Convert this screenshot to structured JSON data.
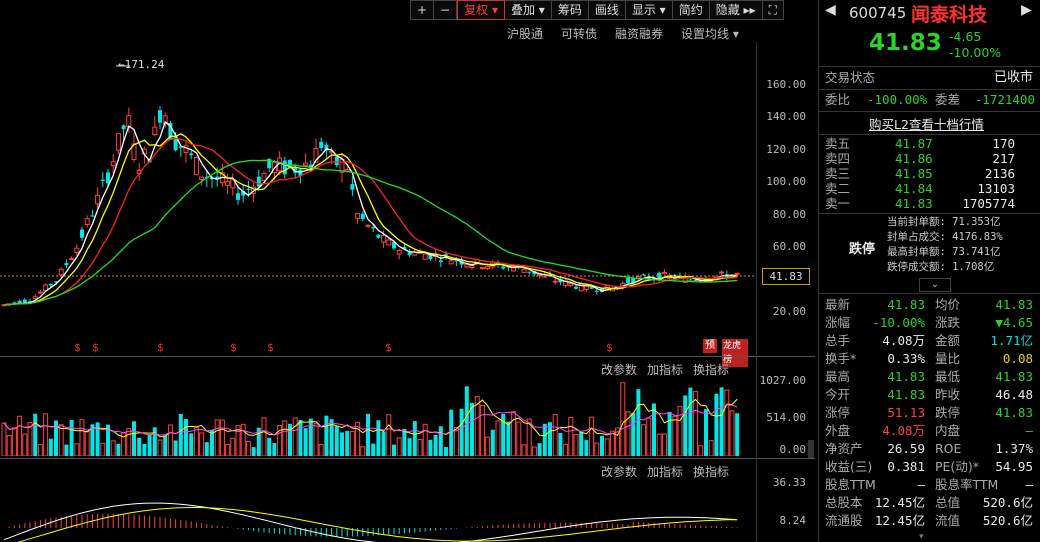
{
  "toolbar": {
    "items": [
      "+",
      "−",
      "复权 ▾",
      "叠加 ▾",
      "筹码",
      "画线",
      "显示 ▾",
      "简约",
      "隐藏 ▸▸",
      "⛶"
    ]
  },
  "sublinks": [
    "沪股通",
    "可转债",
    "融资融券",
    "设置均线 ▾"
  ],
  "main_chart": {
    "peak_annotation": "171.24",
    "price_axis": [
      "160.00",
      "140.00",
      "120.00",
      "100.00",
      "80.00",
      "60.00",
      "20.00"
    ],
    "current_price_tag": "41.83",
    "dollar_marker": "$",
    "tag_yu": "预",
    "tag_rank": "龙虎榜"
  },
  "volume_panel": {
    "buttons": [
      "改参数",
      "加指标",
      "换指标"
    ],
    "axis": [
      "1027.00",
      "514.00",
      "0.00"
    ]
  },
  "macd_panel": {
    "buttons": [
      "改参数",
      "加指标",
      "换指标"
    ],
    "axis": [
      "36.33",
      "8.24"
    ]
  },
  "quote": {
    "code": "600745",
    "name": "闻泰科技",
    "price": "41.83",
    "change": "-4.65",
    "change_pct": "-10.00%",
    "status_label": "交易状态",
    "status_value": "已收市",
    "weibi_label": "委比",
    "weibi_value": "-100.00%",
    "weicha_label": "委差",
    "weicha_value": "-1721400",
    "l2_link": "购买L2查看十档行情",
    "asks": [
      {
        "label": "卖五",
        "price": "41.87",
        "vol": "170"
      },
      {
        "label": "卖四",
        "price": "41.86",
        "vol": "217"
      },
      {
        "label": "卖三",
        "price": "41.85",
        "vol": "2136"
      },
      {
        "label": "卖二",
        "price": "41.84",
        "vol": "13103"
      },
      {
        "label": "卖一",
        "price": "41.83",
        "vol": "1705774"
      }
    ],
    "limit_label": "跌停",
    "limit_info": [
      "当前封单额: 71.353亿",
      "封单占成交: 4176.83%",
      "最高封单额: 73.741亿",
      "跌停成交额: 1.708亿"
    ],
    "stats": [
      {
        "l1": "最新",
        "v1": "41.83",
        "c1": "g",
        "l2": "均价",
        "v2": "41.83",
        "c2": "g"
      },
      {
        "l1": "涨幅",
        "v1": "-10.00%",
        "c1": "g",
        "l2": "涨跌",
        "v2": "▼4.65",
        "c2": "g"
      },
      {
        "l1": "总手",
        "v1": "4.08万",
        "c1": "w",
        "l2": "金额",
        "v2": "1.71亿",
        "c2": "c"
      },
      {
        "l1": "换手*",
        "v1": "0.33%",
        "c1": "w",
        "l2": "量比",
        "v2": "0.08",
        "c2": "y"
      },
      {
        "l1": "最高",
        "v1": "41.83",
        "c1": "g",
        "l2": "最低",
        "v2": "41.83",
        "c2": "g"
      },
      {
        "l1": "今开",
        "v1": "41.83",
        "c1": "g",
        "l2": "昨收",
        "v2": "46.48",
        "c2": "w"
      },
      {
        "l1": "涨停",
        "v1": "51.13",
        "c1": "r",
        "l2": "跌停",
        "v2": "41.83",
        "c2": "g"
      },
      {
        "l1": "外盘",
        "v1": "4.08万",
        "c1": "r",
        "l2": "内盘",
        "v2": "—",
        "c2": "g"
      },
      {
        "l1": "净资产",
        "v1": "26.59",
        "c1": "w",
        "l2": "ROE",
        "v2": "1.37%",
        "c2": "w"
      },
      {
        "l1": "收益(三)",
        "v1": "0.381",
        "c1": "w",
        "l2": "PE(动)*",
        "v2": "54.95",
        "c2": "w"
      },
      {
        "l1": "股息TTM",
        "v1": "—",
        "c1": "w",
        "l2": "股息率TTM",
        "v2": "—",
        "c2": "w"
      },
      {
        "l1": "总股本",
        "v1": "12.45亿",
        "c1": "w",
        "l2": "总值",
        "v2": "520.6亿",
        "c2": "w"
      },
      {
        "l1": "流通股",
        "v1": "12.45亿",
        "c1": "w",
        "l2": "流值",
        "v2": "520.6亿",
        "c2": "w"
      }
    ]
  },
  "colors": {
    "up": "#ff4040",
    "down": "#00e5e5",
    "ma5": "#ffffff",
    "ma10": "#ffff00",
    "ma20": "#ff2020",
    "ma60": "#22dd22"
  }
}
